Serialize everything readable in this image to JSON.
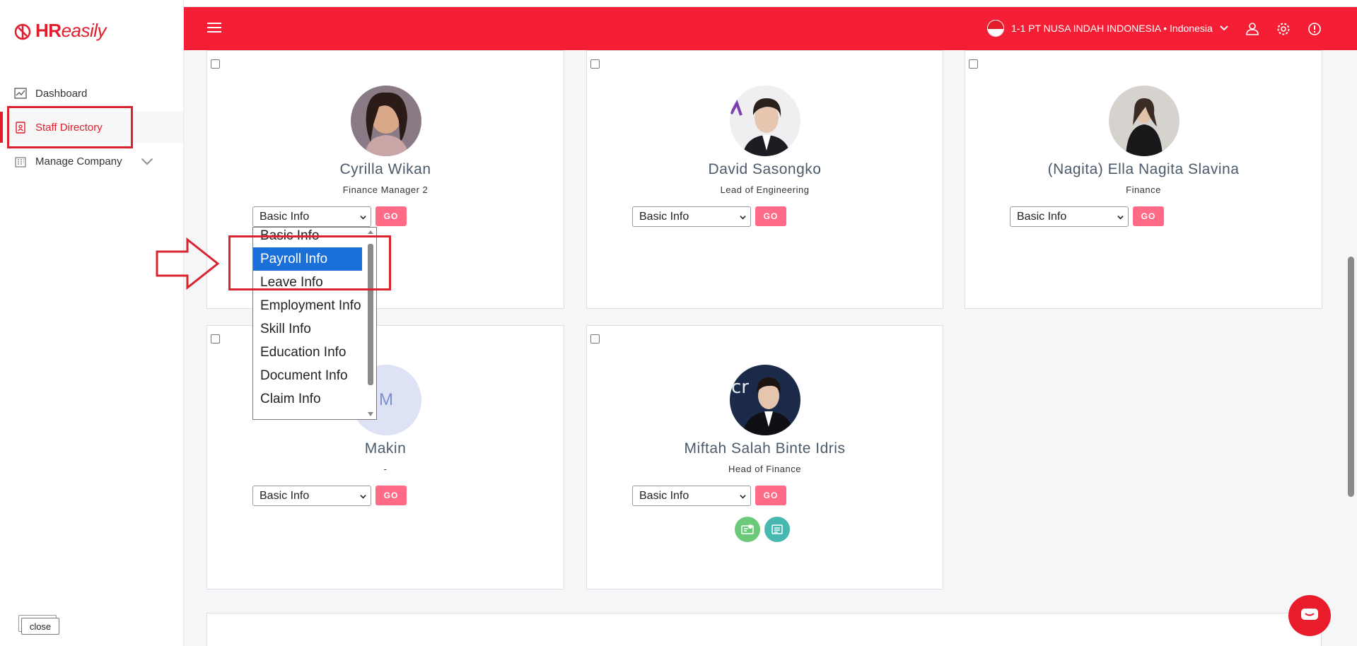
{
  "app": {
    "brand_bold": "HR",
    "brand_light": "easily"
  },
  "sidebar": {
    "items": [
      {
        "label": "Dashboard",
        "icon": "chart-icon"
      },
      {
        "label": "Staff Directory",
        "icon": "clipboard-icon",
        "active": true
      },
      {
        "label": "Manage Company",
        "icon": "building-icon"
      }
    ],
    "close_label": "close"
  },
  "header": {
    "company": "1-1 PT NUSA INDAH INDONESIA • Indonesia"
  },
  "employees": [
    {
      "name": "Cyrilla Wikan",
      "title": "Finance Manager 2",
      "select_value": "Basic Info",
      "go_label": "GO"
    },
    {
      "name": "David Sasongko",
      "title": "Lead of Engineering",
      "select_value": "Basic Info",
      "go_label": "GO"
    },
    {
      "name": "(Nagita) Ella Nagita Slavina",
      "title": "Finance",
      "select_value": "Basic Info",
      "go_label": "GO"
    },
    {
      "name": "Makin",
      "title": "-",
      "select_value": "Basic Info",
      "go_label": "GO",
      "avatar_initial": "M"
    },
    {
      "name": "Miftah Salah Binte Idris",
      "title": "Head of Finance",
      "select_value": "Basic Info",
      "go_label": "GO"
    }
  ],
  "dropdown": {
    "options": [
      "Basic Info",
      "Payroll Info",
      "Leave Info",
      "Employment Info",
      "Skill Info",
      "Education Info",
      "Document Info",
      "Claim Info"
    ],
    "highlighted": "Payroll Info"
  },
  "colors": {
    "brand_red": "#f41e35",
    "go_button": "#ff6b86",
    "selected_option": "#1a6fd9",
    "annotation": "#d92430"
  }
}
